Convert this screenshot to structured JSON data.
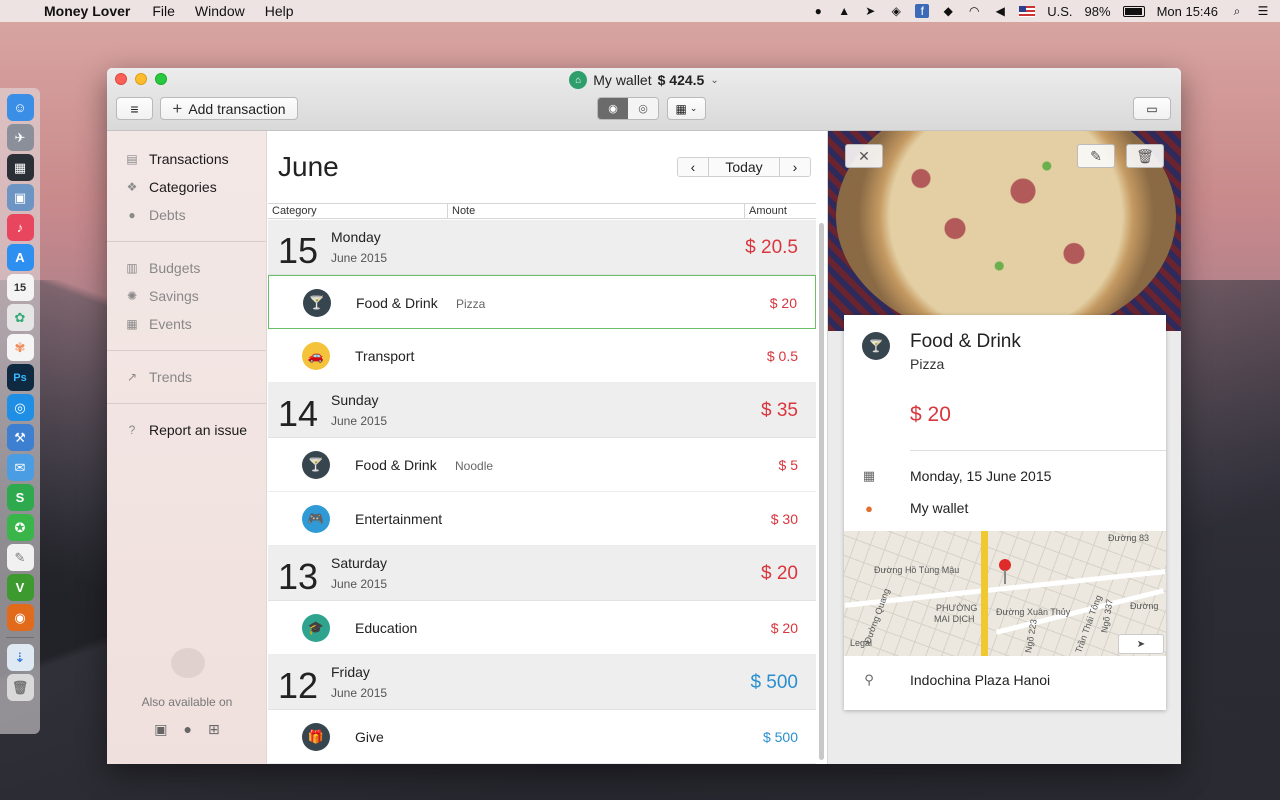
{
  "menubar": {
    "app_name": "Money Lover",
    "menus": [
      "File",
      "Window",
      "Help"
    ],
    "input_source": "U.S.",
    "battery": "98%",
    "clock": "Mon 15:46"
  },
  "window": {
    "wallet_name": "My wallet",
    "wallet_balance": "$ 424.5",
    "add_transaction_label": "Add transaction"
  },
  "sidebar": {
    "items": [
      {
        "label": "Transactions",
        "icon": "list-icon"
      },
      {
        "label": "Categories",
        "icon": "categories-icon"
      },
      {
        "label": "Debts",
        "icon": "person-icon"
      },
      {
        "label": "Budgets",
        "icon": "budget-icon"
      },
      {
        "label": "Savings",
        "icon": "savings-icon"
      },
      {
        "label": "Events",
        "icon": "calendar-icon"
      },
      {
        "label": "Trends",
        "icon": "trend-icon"
      },
      {
        "label": "Report an issue",
        "icon": "help-icon"
      }
    ],
    "also_available": "Also available on"
  },
  "main": {
    "month": "June",
    "today_label": "Today",
    "columns": [
      "Category",
      "Note",
      "Amount"
    ],
    "days": [
      {
        "num": "15",
        "name": "Monday",
        "sub": "June 2015",
        "total": "$ 20.5",
        "color": "#d9363e",
        "tx": [
          {
            "cat": "Food & Drink",
            "note": "Pizza",
            "amt": "$ 20",
            "color": "#d9363e",
            "icon": "food-drink-icon"
          },
          {
            "cat": "Transport",
            "note": "",
            "amt": "$ 0.5",
            "color": "#d9363e",
            "icon": "transport-icon"
          }
        ]
      },
      {
        "num": "14",
        "name": "Sunday",
        "sub": "June 2015",
        "total": "$ 35",
        "color": "#d9363e",
        "tx": [
          {
            "cat": "Food & Drink",
            "note": "Noodle",
            "amt": "$ 5",
            "color": "#d9363e",
            "icon": "food-drink-icon"
          },
          {
            "cat": "Entertainment",
            "note": "",
            "amt": "$ 30",
            "color": "#d9363e",
            "icon": "gamepad-icon"
          }
        ]
      },
      {
        "num": "13",
        "name": "Saturday",
        "sub": "June 2015",
        "total": "$ 20",
        "color": "#d9363e",
        "tx": [
          {
            "cat": "Education",
            "note": "",
            "amt": "$ 20",
            "color": "#d9363e",
            "icon": "graduation-cap-icon"
          }
        ]
      },
      {
        "num": "12",
        "name": "Friday",
        "sub": "June 2015",
        "total": "$ 500",
        "color": "#2a8fd0",
        "tx": [
          {
            "cat": "Give",
            "note": "",
            "amt": "$ 500",
            "color": "#2a8fd0",
            "icon": "give-icon"
          }
        ]
      }
    ]
  },
  "detail": {
    "category": "Food & Drink",
    "note": "Pizza",
    "amount": "$ 20",
    "date": "Monday, 15 June 2015",
    "wallet": "My wallet",
    "location": "Indochina Plaza Hanoi",
    "map_labels": {
      "street1": "Đường Hồ Tùng Mậu",
      "street2": "Đường Xuân Thủy",
      "district": "PHƯỜNG",
      "district2": "MAI DỊCH",
      "street3": "Đường Quang",
      "street4": "Trần Thái Tông",
      "street5": "Ngõ 223",
      "street6": "Ngõ 337",
      "street7": "Đường",
      "street8": "Đường 83",
      "legal": "Legal"
    }
  },
  "colors": {
    "expense": "#d9363e",
    "income": "#2a8fd0",
    "selected_border": "#6bbf67"
  }
}
